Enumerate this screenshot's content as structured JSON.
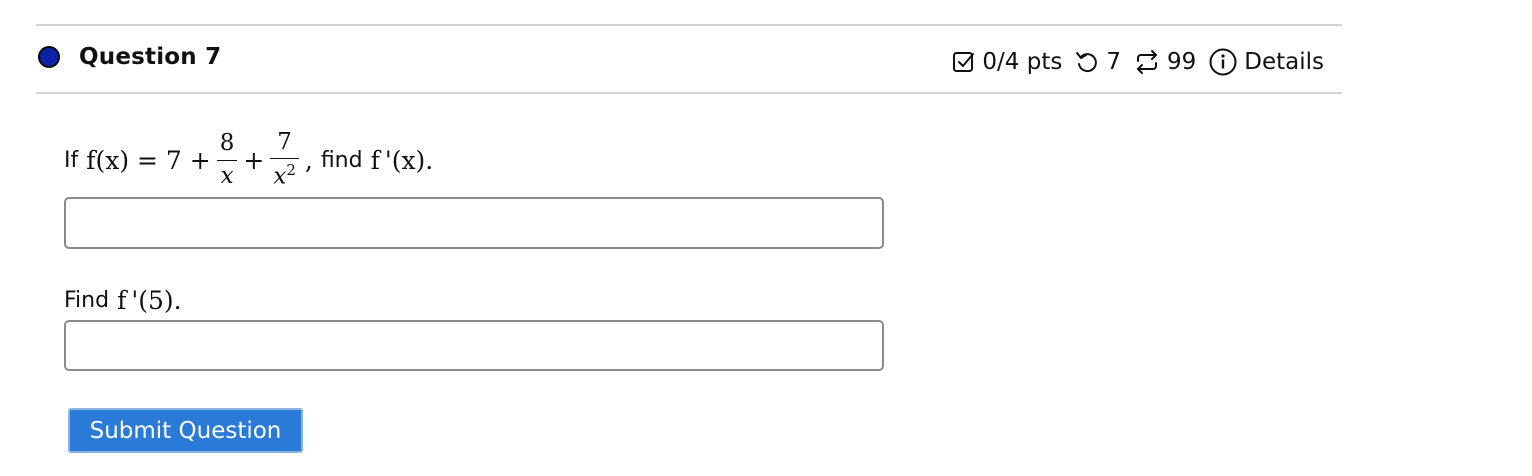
{
  "question": {
    "title": "Question 7",
    "status_color": "#0b21a8"
  },
  "meta": {
    "points": "0/4 pts",
    "attempts": "7",
    "submissions": "99",
    "details_label": "Details",
    "icons": [
      "checkbox-icon",
      "undo-icon",
      "repeat-icon",
      "info-icon"
    ]
  },
  "problem": {
    "if_label": "If",
    "lhs": "f(x) = 7 +",
    "frac1_num": "8",
    "frac1_den": "x",
    "plus": "+",
    "frac2_num": "7",
    "frac2_den": "x",
    "frac2_exp": "2",
    "comma": ",",
    "find_label": "find",
    "target": "f '(x)."
  },
  "part2": {
    "find_label": "Find",
    "target": "f '(5)."
  },
  "answers": {
    "answer1_value": "",
    "answer2_value": ""
  },
  "submit_label": "Submit Question",
  "colors": {
    "accent": "#2a7ad8",
    "rule": "#d4d4d4",
    "input_border": "#8a8a8a"
  }
}
